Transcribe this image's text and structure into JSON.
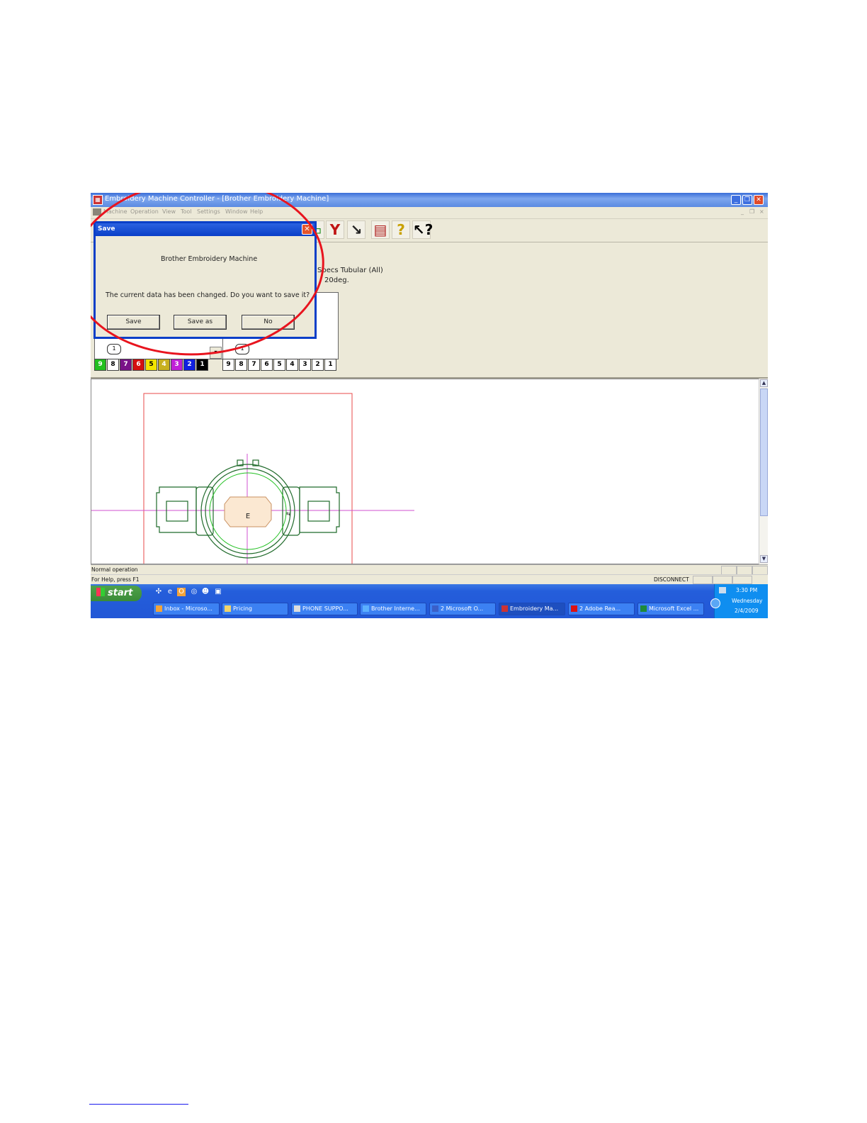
{
  "window": {
    "title": "Embroidery Machine Controller - [Brother Embroidery Machine]",
    "controls": [
      "_",
      "❐",
      "✕"
    ]
  },
  "menu": [
    "Machine",
    "Operation",
    "View",
    "Tool",
    "Settings",
    "Window",
    "Help"
  ],
  "info": {
    "line1": "Specs Tubular (All)",
    "line2": "20deg."
  },
  "needles": {
    "left_numbers": [
      "9",
      "8",
      "7",
      "6",
      "5",
      "4",
      "3",
      "2",
      "1"
    ],
    "left_colors": [
      "#22c01f",
      "#ffffff",
      "#7a1288",
      "#d41010",
      "#f2e400",
      "#c8b020",
      "#c020d8",
      "#1020e0",
      "#000000"
    ],
    "right_numbers": [
      "9",
      "8",
      "7",
      "6",
      "5",
      "4",
      "3",
      "2",
      "1"
    ],
    "oval_label": "1"
  },
  "dialog": {
    "title": "Save",
    "heading": "Brother Embroidery Machine",
    "message": "The current data has been changed.  Do you want to save it?",
    "buttons": {
      "save": "Save",
      "save_as": "Save as",
      "no": "No"
    }
  },
  "canvas": {
    "hoop_label": "E"
  },
  "status": {
    "operation": "Normal operation",
    "help": "For Help, press F1",
    "connection": "DISCONNECT"
  },
  "taskbar": {
    "start": "start",
    "tasks": [
      {
        "label": "Inbox - Microso...",
        "icon": "outlook-icon"
      },
      {
        "label": "Pricing",
        "icon": "folder-icon"
      },
      {
        "label": "PHONE SUPPO...",
        "icon": "window-icon"
      },
      {
        "label": "Brother Interne...",
        "icon": "ie-icon"
      },
      {
        "label": "2 Microsoft O...",
        "icon": "word-icon"
      },
      {
        "label": "Embroidery Ma...",
        "icon": "embroidery-icon"
      },
      {
        "label": "2 Adobe Rea...",
        "icon": "acrobat-icon"
      },
      {
        "label": "Microsoft Excel ...",
        "icon": "excel-icon"
      }
    ],
    "clock": {
      "time": "3:30 PM",
      "day": "Wednesday",
      "date": "2/4/2009"
    }
  }
}
